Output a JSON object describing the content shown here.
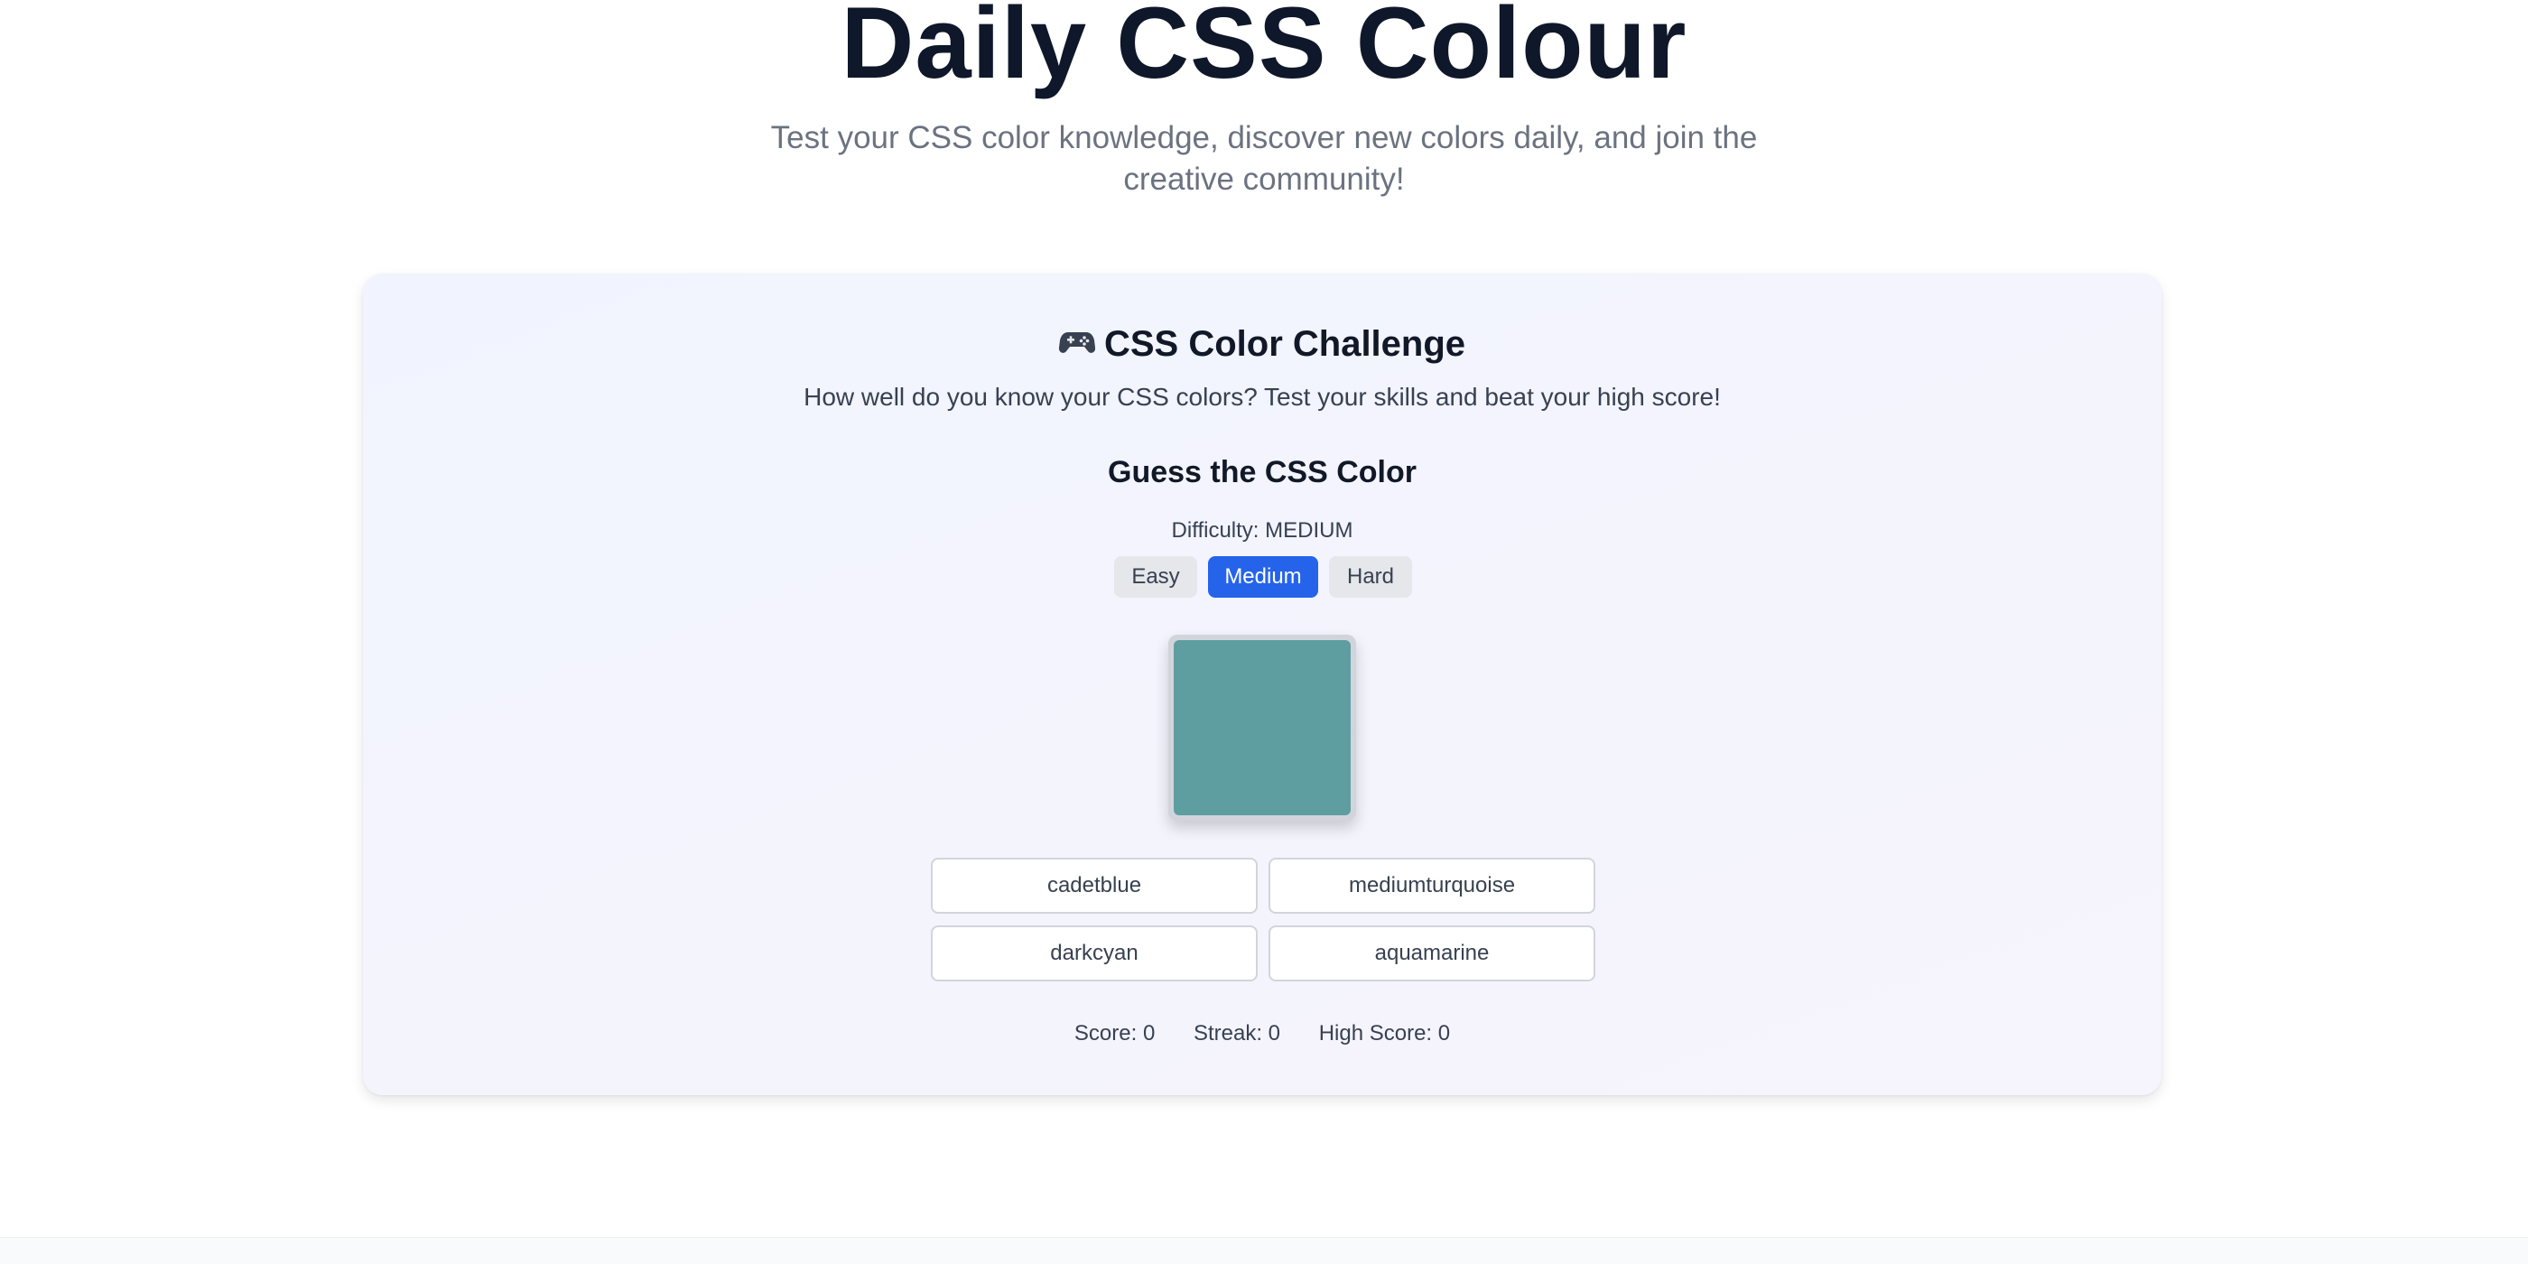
{
  "hero": {
    "title": "Daily CSS Colour",
    "subtitle": "Test your CSS color knowledge, discover new colors daily, and join the creative community!"
  },
  "challenge": {
    "icon": "gamepad-icon",
    "title": "CSS Color Challenge",
    "description": "How well do you know your CSS colors? Test your skills and beat your high score!",
    "game_title": "Guess the CSS Color",
    "difficulty_label": "Difficulty: MEDIUM",
    "difficulty_buttons": [
      {
        "label": "Easy",
        "active": false
      },
      {
        "label": "Medium",
        "active": true
      },
      {
        "label": "Hard",
        "active": false
      }
    ],
    "swatch_color": "#5f9ea0",
    "options": [
      "cadetblue",
      "mediumturquoise",
      "darkcyan",
      "aquamarine"
    ],
    "stats": {
      "score": "Score: 0",
      "streak": "Streak: 0",
      "high_score": "High Score: 0"
    }
  },
  "colors": {
    "accent": "#2563eb",
    "heading": "#0f172a",
    "muted": "#6b7280"
  }
}
